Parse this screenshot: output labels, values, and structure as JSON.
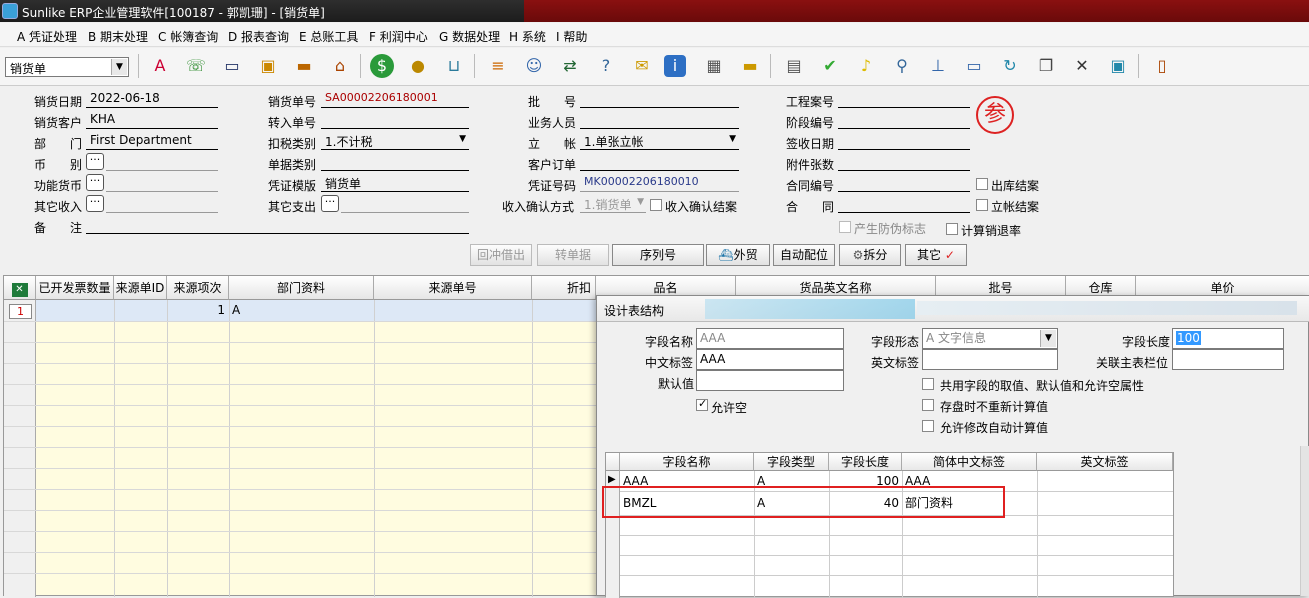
{
  "window": {
    "title": "Sunlike ERP企业管理软件[100187 - 郭凯珊] - [销货单]"
  },
  "menu": [
    {
      "key": "A",
      "label": "A 凭证处理"
    },
    {
      "key": "B",
      "label": "B 期末处理"
    },
    {
      "key": "C",
      "label": "C 帐簿查询"
    },
    {
      "key": "D",
      "label": "D 报表查询"
    },
    {
      "key": "E",
      "label": "E 总账工具"
    },
    {
      "key": "F",
      "label": "F 利润中心"
    },
    {
      "key": "G",
      "label": "G 数据处理"
    },
    {
      "key": "H",
      "label": "H 系统"
    },
    {
      "key": "I",
      "label": "I 帮助"
    }
  ],
  "toolbar": {
    "doc_type": "销货单",
    "icons": [
      "spell-check-icon",
      "phone-icon",
      "computer-icon",
      "lock-icon",
      "briefcase-icon",
      "home-icon",
      "dollar-icon",
      "money-bag-icon",
      "cart-icon",
      "clipboard-icon",
      "users-icon",
      "link-icon",
      "help-icon",
      "mail-icon",
      "info-icon",
      "calculator-icon",
      "folder-icon",
      "document-icon",
      "check-icon",
      "bell-icon",
      "search-icon",
      "org-chart-icon",
      "monitor-icon",
      "refresh-icon",
      "windows-icon",
      "close-icon",
      "restore-icon",
      "exit-icon"
    ]
  },
  "form": {
    "sale_date_label": "销货日期",
    "sale_date": "2022-06-18",
    "customer_label": "销货客户",
    "customer": "KHA",
    "dept_label": "部　　门",
    "dept": "First Department",
    "currency_label": "币　　别",
    "func_currency_label": "功能货币",
    "other_income_label": "其它收入",
    "remark_label": "备　　注",
    "sale_no_label": "销货单号",
    "sale_no": "SA00002206180001",
    "transfer_no_label": "转入单号",
    "tax_type_label": "扣税类别",
    "tax_type": "1.不计税",
    "doc_category_label": "单据类别",
    "voucher_template_label": "凭证模版",
    "voucher_template": "销货单",
    "other_expense_label": "其它支出",
    "batch_no_label": "批　　号",
    "salesman_label": "业务人员",
    "account_label": "立　　帐",
    "account": "1.单张立帐",
    "customer_order_label": "客户订单",
    "voucher_no_label": "凭证号码",
    "voucher_no": "MK00002206180010",
    "income_confirm_label": "收入确认方式",
    "income_confirm": "1.销货单",
    "income_confirm_close_label": "收入确认结案",
    "project_no_label": "工程案号",
    "stage_no_label": "阶段编号",
    "receipt_date_label": "签收日期",
    "attachments_label": "附件张数",
    "contract_no_label": "合同编号",
    "contract_label": "合　　同",
    "ship_close_label": "出库结案",
    "account_close_label": "立帐结案",
    "anti_counterfeit_label": "产生防伪标志",
    "return_rate_label": "计算销退率",
    "stamp": "参"
  },
  "actions": [
    "回冲借出",
    "转单据",
    "序列号",
    "外贸",
    "自动配位",
    "拆分",
    "其它"
  ],
  "grid": {
    "columns": [
      "已开发票数量",
      "来源单ID",
      "来源项次",
      "部门资料",
      "来源单号",
      "折扣",
      "品名",
      "货品英文名称",
      "批号",
      "仓库",
      "单价"
    ],
    "rows": [
      {
        "row_no": "1",
        "seq": "1",
        "dept_data": "A"
      }
    ]
  },
  "dialog": {
    "title": "设计表结构",
    "field_name_label": "字段名称",
    "field_name": "AAA",
    "field_type_label": "字段形态",
    "field_type": "A 文字信息",
    "field_length_label": "字段长度",
    "field_length": "100",
    "cn_label_label": "中文标签",
    "cn_label": "AAA",
    "en_label_label": "英文标签",
    "main_link_label": "关联主表栏位",
    "default_label": "默认值",
    "allow_null_label": "允许空",
    "share_label": "共用字段的取值、默认值和允许空属性",
    "no_recalc_label": "存盘时不重新计算值",
    "allow_edit_label": "允许修改自动计算值",
    "columns": [
      "字段名称",
      "字段类型",
      "字段长度",
      "简体中文标签",
      "英文标签"
    ],
    "rows": [
      {
        "name": "AAA",
        "type": "A",
        "length": "100",
        "cn": "AAA",
        "en": ""
      },
      {
        "name": "BMZL",
        "type": "A",
        "length": "40",
        "cn": "部门资料",
        "en": ""
      }
    ]
  }
}
